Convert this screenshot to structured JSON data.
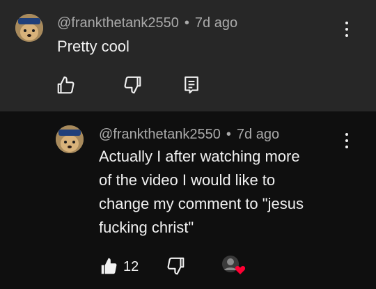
{
  "comment": {
    "username": "@frankthetank2550",
    "separator": "•",
    "time": "7d ago",
    "text": "Pretty cool",
    "actions": {
      "like_icon": "thumbs-up-outline-icon",
      "dislike_icon": "thumbs-down-outline-icon",
      "reply_icon": "reply-comment-icon"
    }
  },
  "reply": {
    "username": "@frankthetank2550",
    "separator": "•",
    "time": "7d ago",
    "text_lines": [
      "Actually I after watching more",
      "of the video I would like to",
      "change my comment to \"jesus",
      "fucking christ\""
    ],
    "like_count": "12",
    "actions": {
      "like_icon": "thumbs-up-filled-icon",
      "dislike_icon": "thumbs-down-outline-icon",
      "creator_heart": "creator-heart-icon"
    }
  },
  "colors": {
    "top_bg": "#272727",
    "reply_bg": "#0f0f0f",
    "text": "#f1f1f1",
    "meta": "#aaaaaa",
    "heart": "#ff0033"
  }
}
